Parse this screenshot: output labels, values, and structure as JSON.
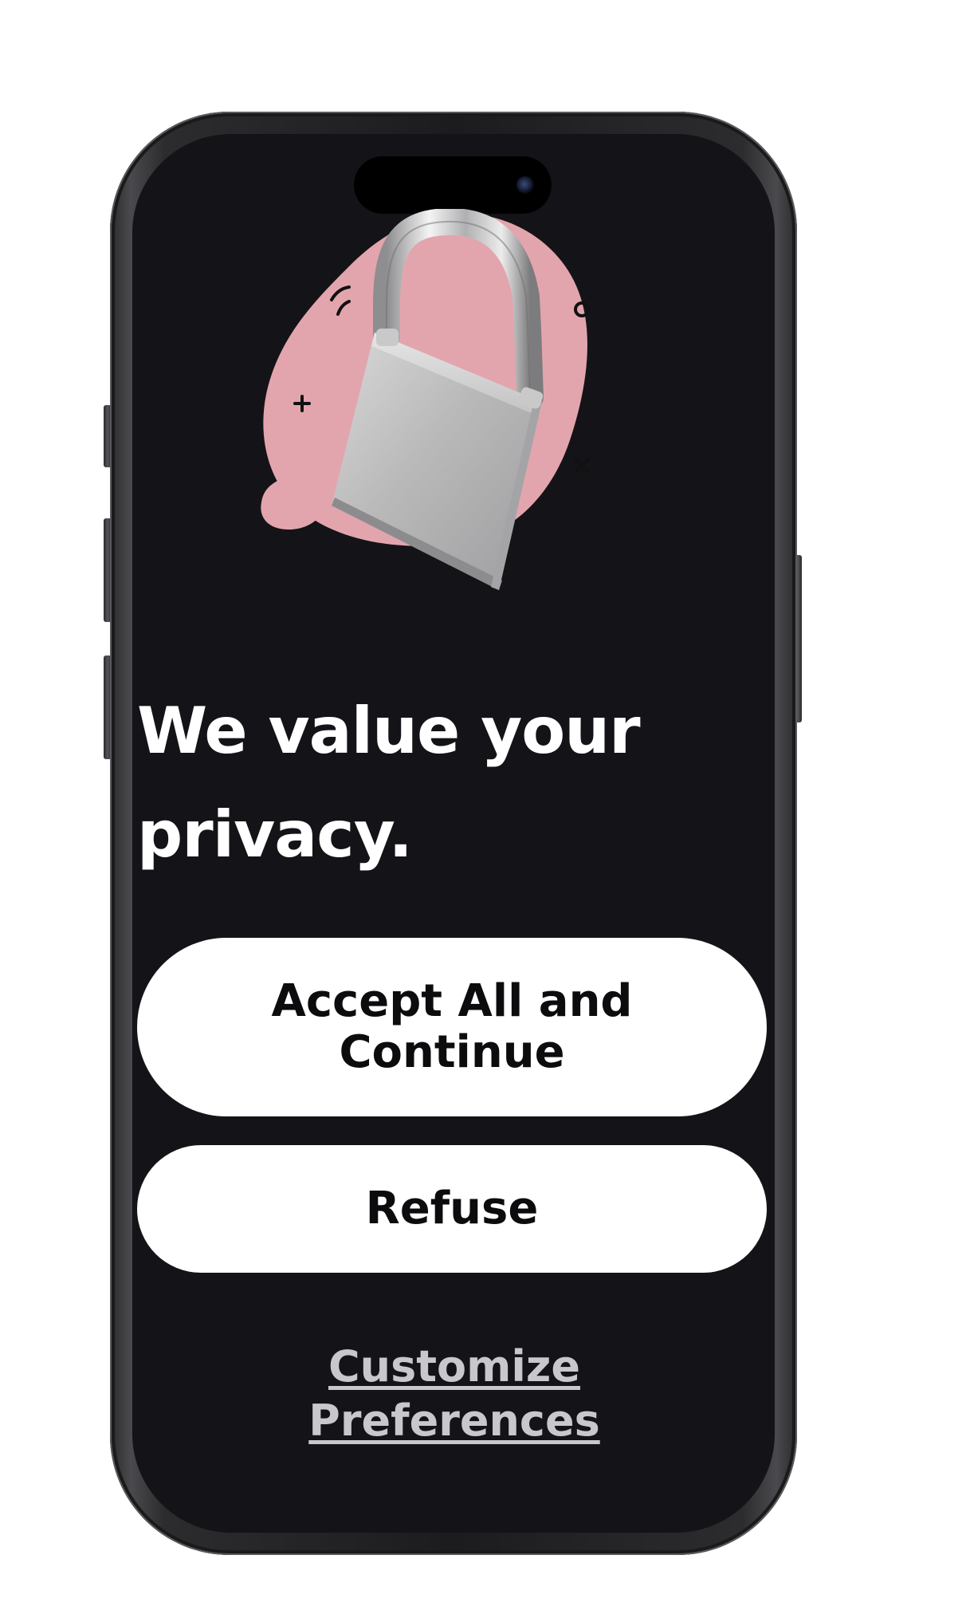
{
  "screen": {
    "headline": "We value your privacy.",
    "illustration_icon": "padlock-icon",
    "colors": {
      "background": "#141418",
      "blob": "#e3a5ad",
      "text": "#ffffff",
      "button_background": "#ffffff",
      "button_text": "#0c0c0e",
      "link": "#c8c8cc"
    }
  },
  "actions": {
    "accept_label": "Accept All and Continue",
    "refuse_label": "Refuse",
    "customize_label": "Customize Preferences"
  }
}
